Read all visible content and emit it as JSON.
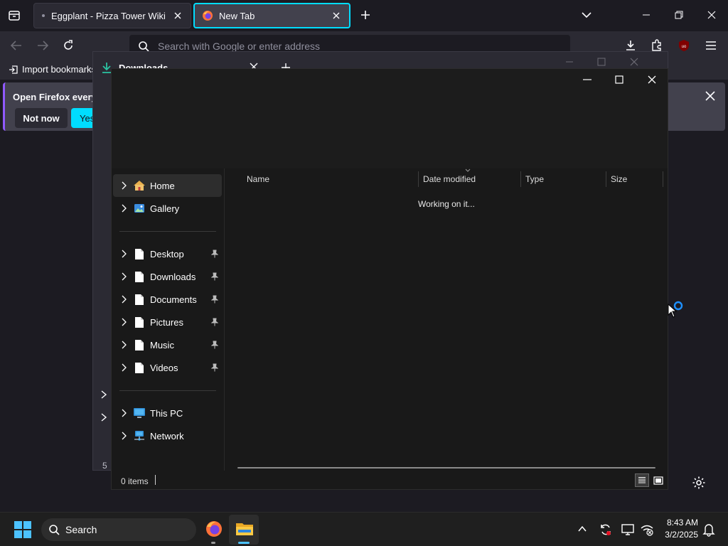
{
  "browser": {
    "tabs": [
      {
        "label": "Eggplant - Pizza Tower Wiki",
        "active": false
      },
      {
        "label": "New Tab",
        "active": true
      }
    ],
    "url_placeholder": "Search with Google or enter address",
    "bookmarks_label": "Import bookmarks",
    "notification": {
      "text": "Open Firefox every",
      "not_now": "Not now",
      "yes": "Yes"
    },
    "accent": "#00ddff"
  },
  "library_window": {
    "tab_label": "Downloads",
    "footer_text": "5"
  },
  "explorer": {
    "nav_items": [
      {
        "label": "Home",
        "icon": "home-icon",
        "pinned": false,
        "selected": true
      },
      {
        "label": "Gallery",
        "icon": "gallery-icon",
        "pinned": false,
        "selected": false
      },
      {
        "label": "Desktop",
        "icon": "document-icon",
        "pinned": true,
        "selected": false
      },
      {
        "label": "Downloads",
        "icon": "document-icon",
        "pinned": true,
        "selected": false
      },
      {
        "label": "Documents",
        "icon": "document-icon",
        "pinned": true,
        "selected": false
      },
      {
        "label": "Pictures",
        "icon": "document-icon",
        "pinned": true,
        "selected": false
      },
      {
        "label": "Music",
        "icon": "document-icon",
        "pinned": true,
        "selected": false
      },
      {
        "label": "Videos",
        "icon": "document-icon",
        "pinned": true,
        "selected": false
      },
      {
        "label": "This PC",
        "icon": "computer-icon",
        "pinned": false,
        "selected": false
      },
      {
        "label": "Network",
        "icon": "network-icon",
        "pinned": false,
        "selected": false
      }
    ],
    "columns": [
      "Name",
      "Date modified",
      "Type",
      "Size"
    ],
    "loading_text": "Working on it...",
    "status_text": "0 items"
  },
  "taskbar": {
    "search_label": "Search",
    "time": "8:43 AM",
    "date": "3/2/2025"
  }
}
